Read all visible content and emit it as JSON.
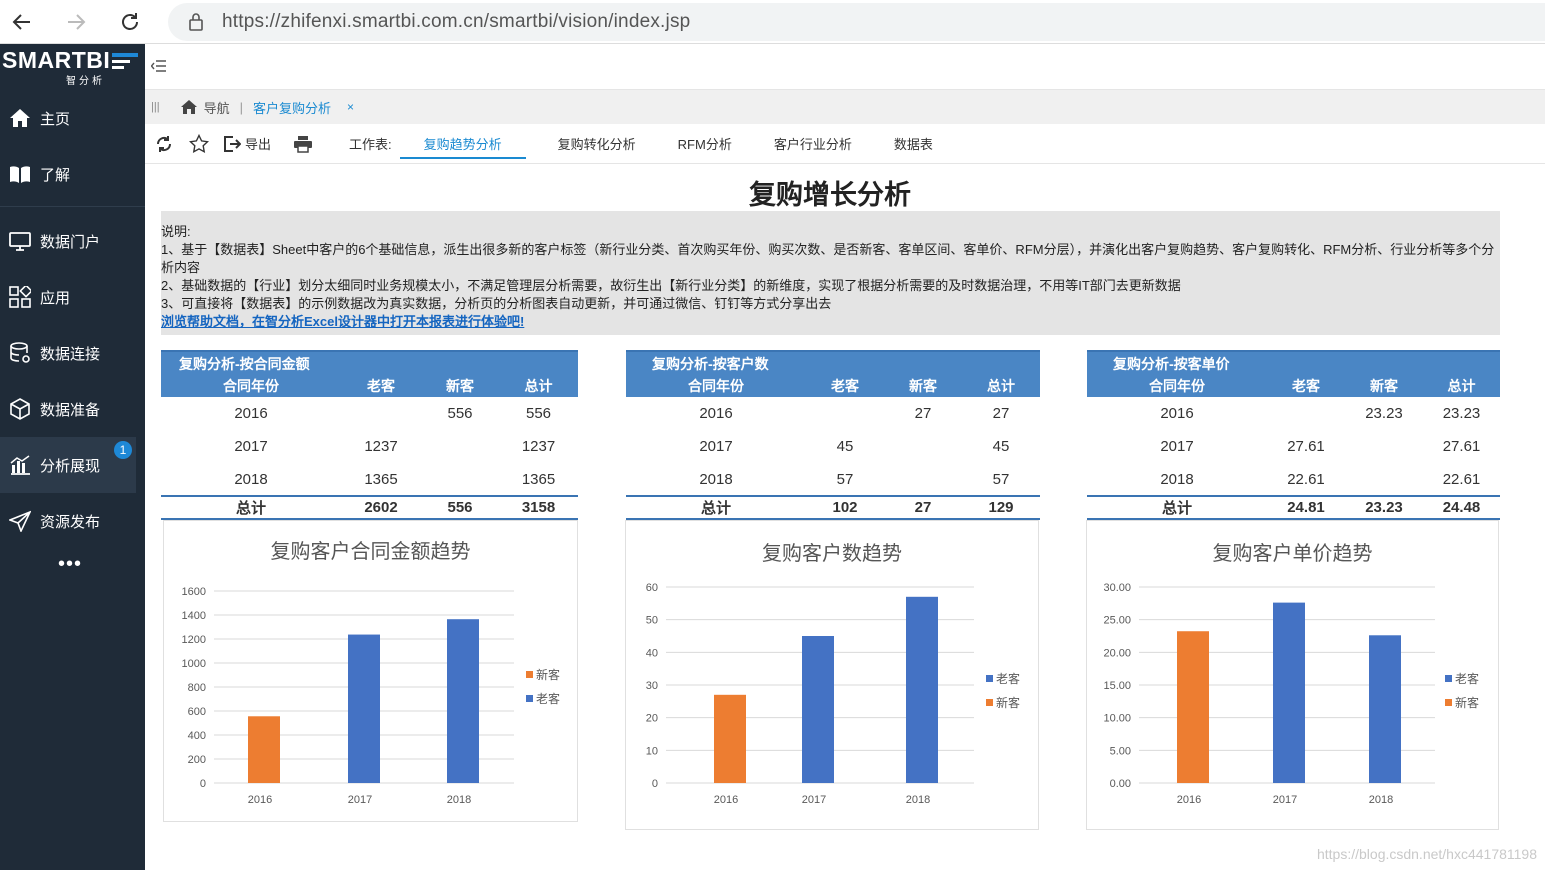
{
  "browser": {
    "url": "https://zhifenxi.smartbi.com.cn/smartbi/vision/index.jsp"
  },
  "sidebar": {
    "logo": "SMARTBI",
    "logo_sub": "智分析",
    "items": [
      {
        "label": "主页",
        "icon": "home-icon"
      },
      {
        "label": "了解",
        "icon": "book-icon"
      },
      {
        "label": "数据门户",
        "icon": "monitor-icon"
      },
      {
        "label": "应用",
        "icon": "apps-icon"
      },
      {
        "label": "数据连接",
        "icon": "database-icon"
      },
      {
        "label": "数据准备",
        "icon": "cube-icon"
      },
      {
        "label": "分析展现",
        "icon": "bar-chart-icon",
        "badge": "1"
      },
      {
        "label": "资源发布",
        "icon": "send-icon"
      }
    ],
    "more": "•••"
  },
  "breadcrumb": {
    "nav_label": "导航",
    "sep": "|",
    "tab_label": "客户复购分析",
    "close": "×"
  },
  "toolbar": {
    "export_label": "导出",
    "sheet_label": "工作表:",
    "tabs": [
      "复购趋势分析",
      "复购转化分析",
      "RFM分析",
      "客户行业分析",
      "数据表"
    ],
    "active_tab": 0
  },
  "report": {
    "title": "复购增长分析",
    "desc_lines": [
      "说明:",
      "1、基于【数据表】Sheet中客户的6个基础信息，派生出很多新的客户标签（新行业分类、首次购买年份、购买次数、是否新客、客单区间、客单价、RFM分层），并演化出客户复购趋势、客户复购转化、RFM分析、行业分析等多个分析内容",
      "2、基础数据的【行业】划分太细同时业务规模太小，不满足管理层分析需要，故衍生出【新行业分类】的新维度，实现了根据分析需要的及时数据治理，不用等IT部门去更新数据",
      "3、可直接将【数据表】的示例数据改为真实数据，分析页的分析图表自动更新，并可通过微信、钉钉等方式分享出去"
    ],
    "desc_link": "浏览帮助文档，在智分析Excel设计器中打开本报表进行体验吧!",
    "tables": [
      {
        "caption": "复购分析-按合同金额",
        "headers": [
          "合同年份",
          "老客",
          "新客",
          "总计"
        ],
        "rows": [
          [
            "2016",
            "",
            "556",
            "556"
          ],
          [
            "2017",
            "1237",
            "",
            "1237"
          ],
          [
            "2018",
            "1365",
            "",
            "1365"
          ]
        ],
        "total": [
          "总计",
          "2602",
          "556",
          "3158"
        ]
      },
      {
        "caption": "复购分析-按客户数",
        "headers": [
          "合同年份",
          "老客",
          "新客",
          "总计"
        ],
        "rows": [
          [
            "2016",
            "",
            "27",
            "27"
          ],
          [
            "2017",
            "45",
            "",
            "45"
          ],
          [
            "2018",
            "57",
            "",
            "57"
          ]
        ],
        "total": [
          "总计",
          "102",
          "27",
          "129"
        ]
      },
      {
        "caption": "复购分析-按客单价",
        "headers": [
          "合同年份",
          "老客",
          "新客",
          "总计"
        ],
        "rows": [
          [
            "2016",
            "",
            "23.23",
            "23.23"
          ],
          [
            "2017",
            "27.61",
            "",
            "27.61"
          ],
          [
            "2018",
            "22.61",
            "",
            "22.61"
          ]
        ],
        "total": [
          "总计",
          "24.81",
          "23.23",
          "24.48"
        ]
      }
    ],
    "colors": {
      "old": "#4472c4",
      "new": "#ed7d31"
    }
  },
  "chart_data": [
    {
      "type": "bar",
      "title": "复购客户合同金额趋势",
      "categories": [
        "2016",
        "2017",
        "2018"
      ],
      "series": [
        {
          "name": "新客",
          "values": [
            556,
            0,
            0
          ],
          "color": "#ed7d31"
        },
        {
          "name": "老客",
          "values": [
            0,
            1237,
            1365
          ],
          "color": "#4472c4"
        }
      ],
      "ylim": [
        0,
        1600
      ],
      "yticks": [
        "0",
        "200",
        "400",
        "600",
        "800",
        "1000",
        "1200",
        "1400",
        "1600"
      ],
      "legend": [
        "新客",
        "老客"
      ]
    },
    {
      "type": "bar",
      "title": "复购客户数趋势",
      "categories": [
        "2016",
        "2017",
        "2018"
      ],
      "series": [
        {
          "name": "老客",
          "values": [
            0,
            45,
            57
          ],
          "color": "#4472c4"
        },
        {
          "name": "新客",
          "values": [
            27,
            0,
            0
          ],
          "color": "#ed7d31"
        }
      ],
      "ylim": [
        0,
        60
      ],
      "yticks": [
        "0",
        "10",
        "20",
        "30",
        "40",
        "50",
        "60"
      ],
      "legend": [
        "老客",
        "新客"
      ]
    },
    {
      "type": "bar",
      "title": "复购客户单价趋势",
      "categories": [
        "2016",
        "2017",
        "2018"
      ],
      "series": [
        {
          "name": "老客",
          "values": [
            0,
            27.61,
            22.61
          ],
          "color": "#4472c4"
        },
        {
          "name": "新客",
          "values": [
            23.23,
            0,
            0
          ],
          "color": "#ed7d31"
        }
      ],
      "ylim": [
        0,
        30
      ],
      "yticks": [
        "0.00",
        "5.00",
        "10.00",
        "15.00",
        "20.00",
        "25.00",
        "30.00"
      ],
      "legend": [
        "老客",
        "新客"
      ]
    }
  ],
  "watermark": "https://blog.csdn.net/hxc441781198"
}
